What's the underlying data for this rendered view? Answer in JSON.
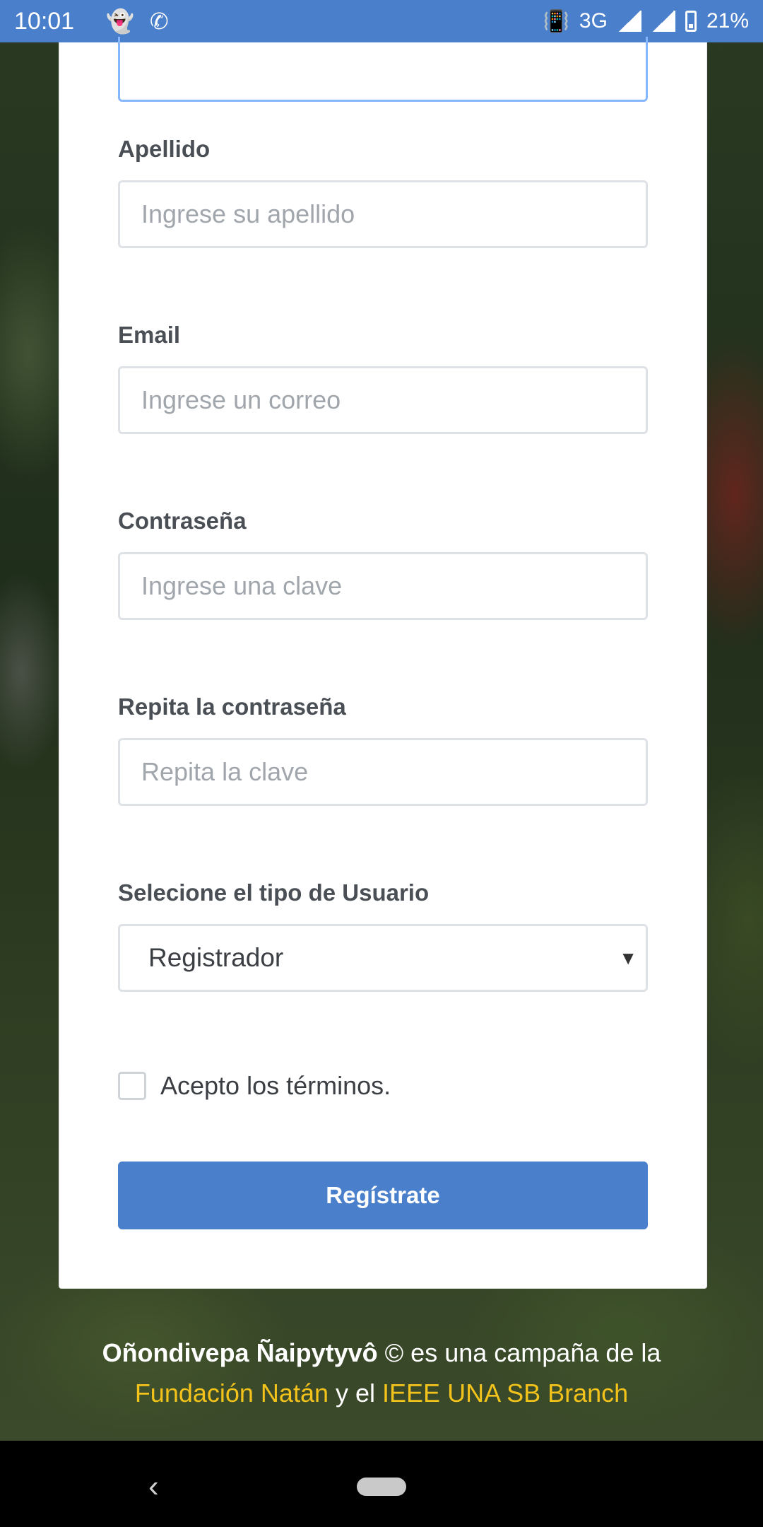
{
  "status_bar": {
    "time": "10:01",
    "network": "3G",
    "battery": "21%",
    "notification_icons": [
      "snapchat-icon",
      "whatsapp-icon"
    ]
  },
  "form": {
    "apellido": {
      "label": "Apellido",
      "placeholder": "Ingrese su apellido"
    },
    "email": {
      "label": "Email",
      "placeholder": "Ingrese un correo"
    },
    "password": {
      "label": "Contraseña",
      "placeholder": "Ingrese una clave"
    },
    "password_repeat": {
      "label": "Repita la contraseña",
      "placeholder": "Repita la clave"
    },
    "user_type": {
      "label": "Selecione el tipo de Usuario",
      "selected": "Registrador"
    },
    "terms_label": "Acepto los términos.",
    "terms_checked": false,
    "submit_label": "Regístrate"
  },
  "footer": {
    "brand": "Oñondivepa Ñaipytyvô",
    "text_1": " © es una campaña de la",
    "link_1": "Fundación Natán",
    "text_2": " y el ",
    "link_2": "IEEE UNA SB Branch"
  },
  "colors": {
    "accent": "#4a7fcb",
    "link": "#f3c21b",
    "focus_border": "#86b7fe"
  }
}
